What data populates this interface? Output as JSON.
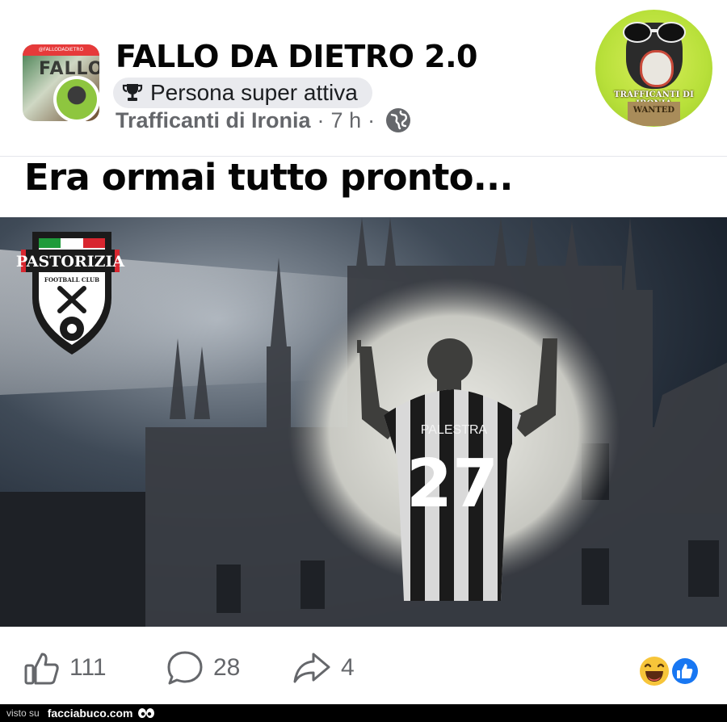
{
  "post": {
    "group_name": "FALLO DA DIETRO 2.0",
    "badge_label": "Persona super attiva",
    "author": "Trafficanti di Ironia",
    "separator": "·",
    "time": "7 h",
    "text": "Era ormai tutto pronto...",
    "visibility_icon": "globe-icon",
    "group_avatar_banner": "FALLO",
    "corner_logo": {
      "line1": "TRAFFICANTI DI IRONIA",
      "line2": "WANTED"
    }
  },
  "image": {
    "club_name": "PASTORIZIA",
    "club_sub": "FOOTBALL CLUB",
    "shirt_name": "PALESTRA",
    "shirt_number": "27"
  },
  "actions": {
    "likes": "111",
    "comments": "28",
    "shares": "4",
    "like_icon": "thumbs-up-icon",
    "comment_icon": "comment-bubble-icon",
    "share_icon": "share-arrow-icon",
    "reaction_icons": [
      "laughing-emoji-icon",
      "like-reaction-icon"
    ]
  },
  "footer": {
    "prefix": "visto su",
    "site": "facciabuco.com"
  },
  "colors": {
    "text_primary": "#050505",
    "text_secondary": "#65676b",
    "badge_bg": "#e9eaee",
    "like_blue": "#1877f2",
    "logo_green": "#b8e03a"
  }
}
